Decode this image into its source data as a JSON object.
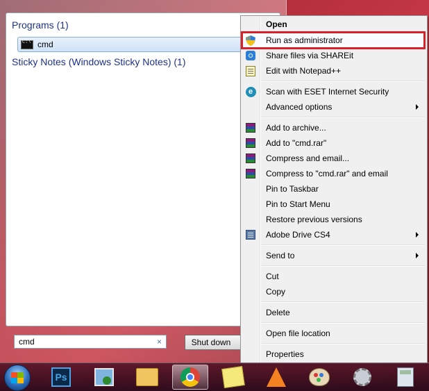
{
  "start_menu": {
    "groups": [
      {
        "header": "Programs (1)",
        "items": [
          {
            "label": "cmd",
            "icon": "cmd-icon",
            "selected": true
          }
        ]
      },
      {
        "header": "Sticky Notes (Windows Sticky Notes) (1)",
        "items": []
      }
    ],
    "search": {
      "value": "cmd",
      "clear_glyph": "×"
    },
    "shutdown_label": "Shut down"
  },
  "context_menu": {
    "items": [
      {
        "label": "Open",
        "bold": true
      },
      {
        "label": "Run as administrator",
        "icon": "uac-shield-icon",
        "highlighted": true
      },
      {
        "label": "Share files via SHAREit",
        "icon": "shareit-icon"
      },
      {
        "label": "Edit with Notepad++",
        "icon": "notepadpp-icon"
      },
      {
        "label": "Scan with ESET Internet Security",
        "icon": "eset-icon"
      },
      {
        "label": "Advanced options",
        "submenu": true
      },
      {
        "label": "Add to archive...",
        "icon": "winrar-icon"
      },
      {
        "label": "Add to \"cmd.rar\"",
        "icon": "winrar-icon"
      },
      {
        "label": "Compress and email...",
        "icon": "winrar-icon"
      },
      {
        "label": "Compress to \"cmd.rar\" and email",
        "icon": "winrar-icon"
      },
      {
        "label": "Pin to Taskbar"
      },
      {
        "label": "Pin to Start Menu"
      },
      {
        "label": "Restore previous versions"
      },
      {
        "label": "Adobe Drive CS4",
        "icon": "adobe-drive-icon",
        "submenu": true
      },
      {
        "label": "Send to",
        "submenu": true
      },
      {
        "label": "Cut"
      },
      {
        "label": "Copy"
      },
      {
        "label": "Delete"
      },
      {
        "label": "Open file location"
      },
      {
        "label": "Properties"
      }
    ]
  },
  "taskbar": {
    "ps_label": "Ps",
    "pinned": [
      "photoshop-icon",
      "remote-desktop-icon",
      "file-explorer-icon",
      "chrome-icon",
      "sticky-notes-icon",
      "vlc-icon",
      "paint-icon",
      "settings-icon",
      "calculator-icon"
    ],
    "active": "chrome-icon"
  },
  "colors": {
    "highlight_outline": "#d8222b",
    "group_header": "#1e3287",
    "desktop": "#b4303c"
  }
}
